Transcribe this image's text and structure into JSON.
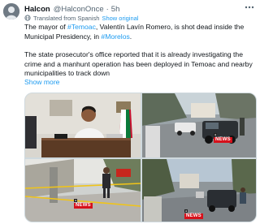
{
  "author": {
    "name": "Halcon",
    "handle": "@HalconOnce",
    "separator": "·",
    "time": "5h",
    "avatar_icon": "avatar-silhouette-icon"
  },
  "menu_icon": "more-horizontal-icon",
  "translation": {
    "icon": "globe-icon",
    "text": "Translated from Spanish",
    "show_original": "Show original"
  },
  "paragraph1": {
    "before_tag1": "The mayor of ",
    "tag1": "#Temoac",
    "middle": ", Valentín Lavín Romero, is shot dead inside the Municipal Presidency, in ",
    "tag2": "#Morelos",
    "after": "."
  },
  "paragraph2": "The state prosecutor's office reported that it is already investigating the crime and a manhunt operation has been deployed in Temoac and nearby municipalities to track down",
  "show_more": "Show more",
  "media": {
    "badge_label": "NEWS",
    "colors": {
      "badge": "#d6111b",
      "link": "#1d9bf0",
      "muted": "#536471"
    }
  }
}
